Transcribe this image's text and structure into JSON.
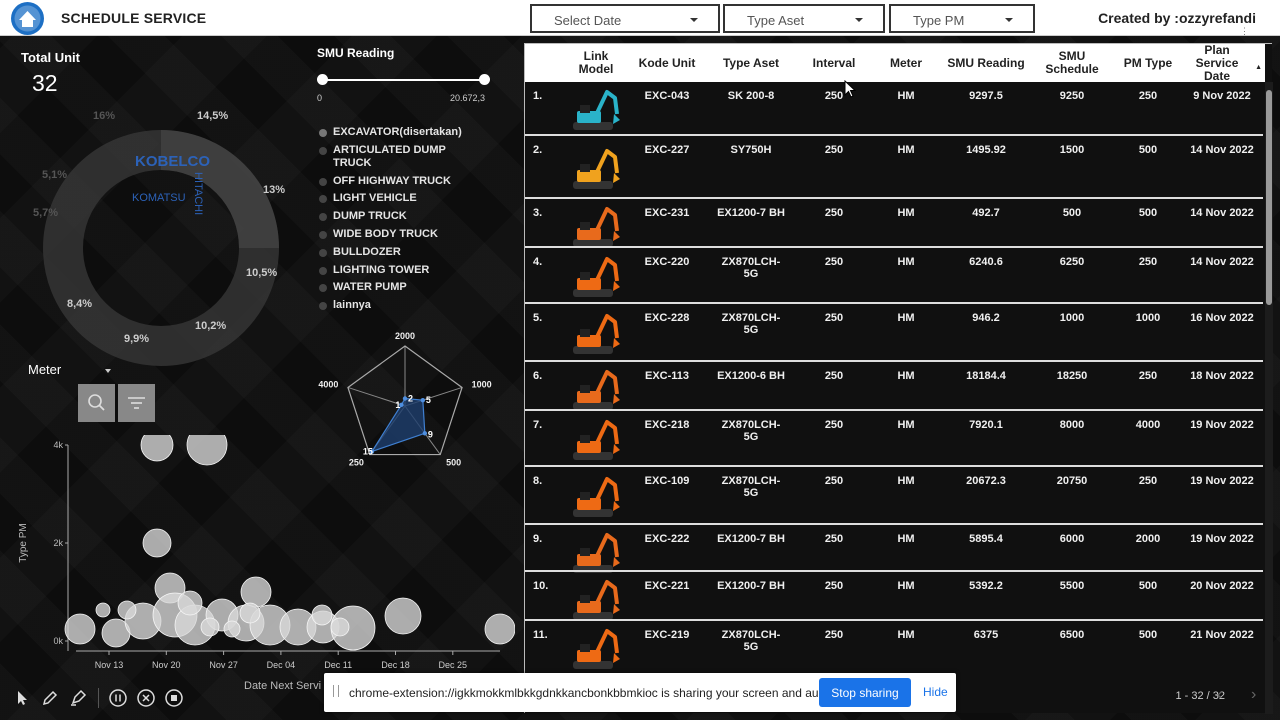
{
  "header": {
    "title": "SCHEDULE SERVICE",
    "filters": [
      {
        "label": "Select Date"
      },
      {
        "label": "Type Aset"
      },
      {
        "label": "Type PM"
      }
    ],
    "creator": "Created by :ozzyrefandi",
    "menu_glyph": "⋮"
  },
  "summary": {
    "total_unit_label": "Total Unit",
    "total_unit_value": "32"
  },
  "donut": {
    "brands": [
      "KOBELCO",
      "KOMATSU",
      "HITACHI"
    ],
    "percent_labels": [
      "14,5%",
      "13%",
      "10,5%",
      "10,2%",
      "9,9%",
      "8,4%",
      "5,7%",
      "5,1%",
      "16%"
    ]
  },
  "smu_slider": {
    "label": "SMU Reading",
    "min_label": "0",
    "max_label": "20.672,3",
    "range": [
      0,
      1
    ]
  },
  "asset_legend": {
    "items": [
      "EXCAVATOR(disertakan)",
      "ARTICULATED DUMP TRUCK",
      "OFF HIGHWAY TRUCK",
      "LIGHT VEHICLE",
      "DUMP TRUCK",
      "WIDE BODY TRUCK",
      "BULLDOZER",
      "LIGHTING TOWER",
      "WATER PUMP",
      "lainnya"
    ]
  },
  "meter_filter": {
    "label": "Meter",
    "icons": [
      "zoom-icon",
      "filter-icon"
    ]
  },
  "chart_data": [
    {
      "type": "radar",
      "axes": [
        "2000",
        "1000",
        "500",
        "250",
        "4000"
      ],
      "values": [
        2,
        5,
        9,
        15,
        1
      ],
      "value_labels": [
        "2",
        "5",
        "9",
        "15",
        "1"
      ]
    },
    {
      "type": "scatter",
      "xlabel": "Date Next Servi",
      "ylabel": "Type PM",
      "x_ticks": [
        "Nov 13",
        "Nov 20",
        "Nov 27",
        "Dec 04",
        "Dec 11",
        "Dec 18",
        "Dec 25"
      ],
      "y_ticks": [
        "0k",
        "2k",
        "4k"
      ],
      "ylim": [
        0,
        4000
      ]
    }
  ],
  "table": {
    "columns": [
      "Link Model",
      "Kode Unit",
      "Type Aset",
      "Interval",
      "Meter",
      "SMU Reading",
      "SMU Schedule",
      "PM Type",
      "Plan Service Date"
    ],
    "sort_glyph": "▲",
    "rows": [
      {
        "no": "1.",
        "kode": "EXC-043",
        "type": "SK 200-8",
        "interval": "250",
        "meter": "HM",
        "smu": "9297.5",
        "schedule": "9250",
        "pm": "250",
        "date": "9 Nov 2022",
        "color": "#2ab3c9"
      },
      {
        "no": "2.",
        "kode": "EXC-227",
        "type": "SY750H",
        "interval": "250",
        "meter": "HM",
        "smu": "1495.92",
        "schedule": "1500",
        "pm": "500",
        "date": "14 Nov 2022",
        "color": "#f0a21e"
      },
      {
        "no": "3.",
        "kode": "EXC-231",
        "type": "EX1200-7 BH",
        "interval": "250",
        "meter": "HM",
        "smu": "492.7",
        "schedule": "500",
        "pm": "500",
        "date": "14 Nov 2022",
        "color": "#e86a1c"
      },
      {
        "no": "4.",
        "kode": "EXC-220",
        "type": "ZX870LCH-5G",
        "interval": "250",
        "meter": "HM",
        "smu": "6240.6",
        "schedule": "6250",
        "pm": "250",
        "date": "14 Nov 2022",
        "color": "#ee6a14"
      },
      {
        "no": "5.",
        "kode": "EXC-228",
        "type": "ZX870LCH-5G",
        "interval": "250",
        "meter": "HM",
        "smu": "946.2",
        "schedule": "1000",
        "pm": "1000",
        "date": "16 Nov 2022",
        "color": "#ee6a14"
      },
      {
        "no": "6.",
        "kode": "EXC-113",
        "type": "EX1200-6 BH",
        "interval": "250",
        "meter": "HM",
        "smu": "18184.4",
        "schedule": "18250",
        "pm": "250",
        "date": "18 Nov 2022",
        "color": "#e86a1c"
      },
      {
        "no": "7.",
        "kode": "EXC-218",
        "type": "ZX870LCH-5G",
        "interval": "250",
        "meter": "HM",
        "smu": "7920.1",
        "schedule": "8000",
        "pm": "4000",
        "date": "19 Nov 2022",
        "color": "#ee6a14"
      },
      {
        "no": "8.",
        "kode": "EXC-109",
        "type": "ZX870LCH-5G",
        "interval": "250",
        "meter": "HM",
        "smu": "20672.3",
        "schedule": "20750",
        "pm": "250",
        "date": "19 Nov 2022",
        "color": "#ee6a14"
      },
      {
        "no": "9.",
        "kode": "EXC-222",
        "type": "EX1200-7 BH",
        "interval": "250",
        "meter": "HM",
        "smu": "5895.4",
        "schedule": "6000",
        "pm": "2000",
        "date": "19 Nov 2022",
        "color": "#e86a1c"
      },
      {
        "no": "10.",
        "kode": "EXC-221",
        "type": "EX1200-7 BH",
        "interval": "250",
        "meter": "HM",
        "smu": "5392.2",
        "schedule": "5500",
        "pm": "500",
        "date": "20 Nov 2022",
        "color": "#e86a1c"
      },
      {
        "no": "11.",
        "kode": "EXC-219",
        "type": "ZX870LCH-5G",
        "interval": "250",
        "meter": "HM",
        "smu": "6375",
        "schedule": "6500",
        "pm": "500",
        "date": "21 Nov 2022",
        "color": "#ee6a14"
      }
    ],
    "pager": "1 - 32 / 32"
  },
  "share_bar": {
    "message": "chrome-extension://igkkmokkmlbkkgdnkkancbonkbbmkioc is sharing your screen and audio.",
    "stop_label": "Stop sharing",
    "hide_label": "Hide"
  },
  "colors": {
    "brand_blue": "#2c62b8",
    "share_blue": "#1a73e8",
    "radar_fill": "#1e3f6e"
  }
}
